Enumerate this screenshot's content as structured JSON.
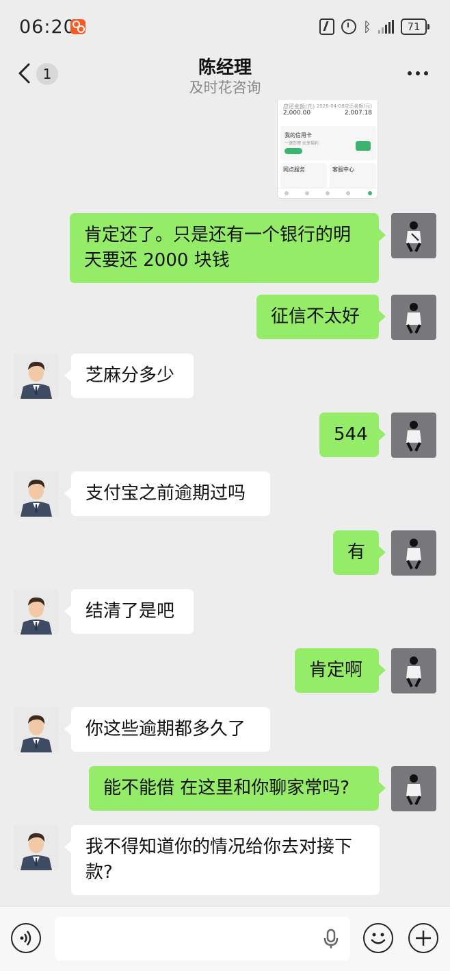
{
  "status_bar": {
    "time": "06:20",
    "battery": "71",
    "icons": [
      "nfc-icon",
      "alarm-icon",
      "bluetooth-icon",
      "signal-icon",
      "battery-icon"
    ]
  },
  "header": {
    "back_badge": "1",
    "title": "陈经理",
    "subtitle": "及时花咨询",
    "more_icon": "more-icon"
  },
  "shared_screenshot": {
    "left_label": "应还金额(元)",
    "left_value": "2,000.00",
    "right_label": "2026-04-08应还金额(元)",
    "right_value": "2,007.18",
    "card_title": "我的信用卡",
    "card_sub": "一键办理 优享福利",
    "service_left": "网点服务",
    "service_right": "客服中心"
  },
  "messages": [
    {
      "from": "me",
      "text": "肯定还了。只是还有一个银行的明天要还 2000 块钱"
    },
    {
      "from": "me",
      "text": "征信不太好"
    },
    {
      "from": "other",
      "text": "芝麻分多少"
    },
    {
      "from": "me",
      "text": "544"
    },
    {
      "from": "other",
      "text": "支付宝之前逾期过吗"
    },
    {
      "from": "me",
      "text": "有"
    },
    {
      "from": "other",
      "text": "结清了是吧"
    },
    {
      "from": "me",
      "text": "肯定啊"
    },
    {
      "from": "other",
      "text": "你这些逾期都多久了"
    },
    {
      "from": "me",
      "text": "能不能借 在这里和你聊家常吗?"
    },
    {
      "from": "other",
      "text": "我不得知道你的情况给你去对接下款?"
    }
  ],
  "input_bar": {
    "voice_icon": "voice-icon",
    "mic_icon": "mic-icon",
    "emoji_icon": "emoji-icon",
    "plus_icon": "plus-icon",
    "value": ""
  }
}
